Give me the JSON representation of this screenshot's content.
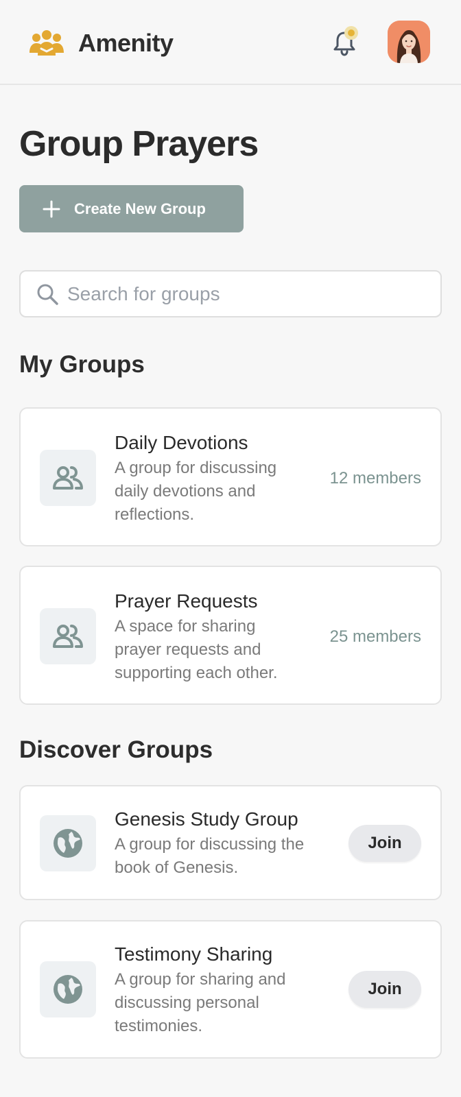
{
  "header": {
    "brand_name": "Amenity",
    "logo_icon": "people-group-icon",
    "notification_icon": "bell-icon",
    "avatar_icon": "user-avatar",
    "colors": {
      "brand": "#e3a832",
      "notification_dot": "#e6b436",
      "avatar_bg": "#f08d66"
    }
  },
  "page": {
    "title": "Group Prayers"
  },
  "create_button": {
    "label": "Create New Group",
    "icon": "plus-icon",
    "color": "#8fa19f"
  },
  "search": {
    "placeholder": "Search for groups",
    "value": "",
    "icon": "search-icon"
  },
  "my_groups": {
    "title": "My Groups",
    "items": [
      {
        "name": "Daily Devotions",
        "description": "A group for discussing\ndaily devotions and\nreflections.",
        "members": "12 members",
        "icon": "people-icon"
      },
      {
        "name": "Prayer Requests",
        "description": "A space for sharing\nprayer requests and\nsupporting each other.",
        "members": "25 members",
        "icon": "people-icon"
      }
    ]
  },
  "discover_groups": {
    "title": "Discover Groups",
    "items": [
      {
        "name": "Genesis Study Group",
        "description": "A group for discussing the\nbook of Genesis.",
        "join_label": "Join",
        "icon": "globe-icon"
      },
      {
        "name": "Testimony Sharing",
        "description": "A group for sharing and\ndiscussing personal\ntestimonies.",
        "join_label": "Join",
        "icon": "globe-icon"
      }
    ]
  }
}
